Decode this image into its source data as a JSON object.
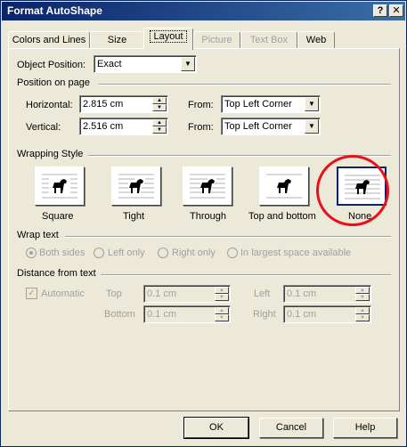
{
  "window": {
    "title": "Format AutoShape",
    "help_btn": "?",
    "close_btn": "✕"
  },
  "tabs": [
    {
      "label": "Colors and Lines",
      "active": false,
      "disabled": false
    },
    {
      "label": "Size",
      "active": false,
      "disabled": false
    },
    {
      "label": "Layout",
      "active": true,
      "disabled": false
    },
    {
      "label": "Picture",
      "active": false,
      "disabled": true
    },
    {
      "label": "Text Box",
      "active": false,
      "disabled": true
    },
    {
      "label": "Web",
      "active": false,
      "disabled": false
    }
  ],
  "object_position": {
    "label": "Object Position:",
    "value": "Exact"
  },
  "position_on_page": {
    "heading": "Position on page",
    "horizontal_label": "Horizontal:",
    "horizontal_value": "2.815 cm",
    "vertical_label": "Vertical:",
    "vertical_value": "2.516 cm",
    "from_label": "From:",
    "horizontal_from": "Top Left Corner",
    "vertical_from": "Top Left Corner"
  },
  "wrapping_style": {
    "heading": "Wrapping Style",
    "options": [
      {
        "label": "Square",
        "selected": false
      },
      {
        "label": "Tight",
        "selected": false
      },
      {
        "label": "Through",
        "selected": false
      },
      {
        "label": "Top and bottom",
        "selected": false
      },
      {
        "label": "None",
        "selected": true
      }
    ]
  },
  "wrap_text": {
    "heading": "Wrap text",
    "options": [
      "Both sides",
      "Left only",
      "Right only",
      "In largest space available"
    ],
    "selected": "Both sides"
  },
  "distance_from_text": {
    "heading": "Distance from text",
    "automatic_label": "Automatic",
    "automatic_checked": true,
    "top_label": "Top",
    "top_value": "0.1 cm",
    "bottom_label": "Bottom",
    "bottom_value": "0.1 cm",
    "left_label": "Left",
    "left_value": "0.1 cm",
    "right_label": "Right",
    "right_value": "0.1 cm"
  },
  "buttons": {
    "ok": "OK",
    "cancel": "Cancel",
    "help": "Help"
  },
  "colors": {
    "title_bar": "#0a246a",
    "face": "#ece9d8",
    "highlight_circle": "#e8101a"
  }
}
